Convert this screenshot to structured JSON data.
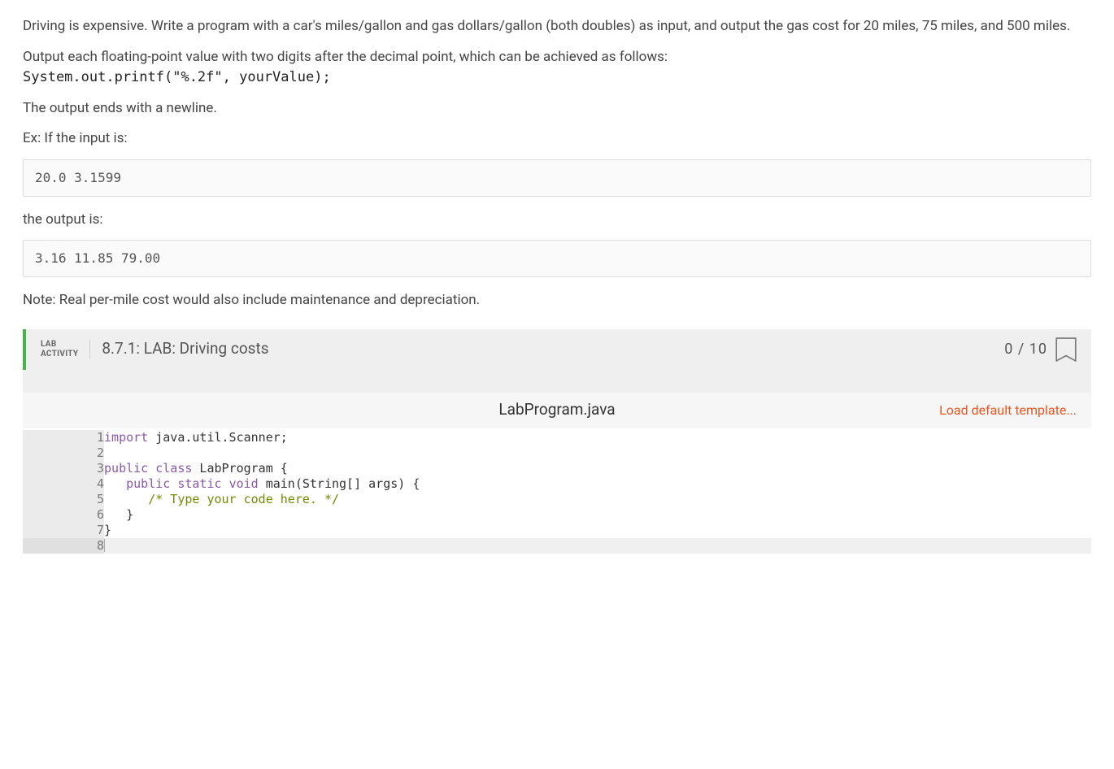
{
  "problem": {
    "p1": "Driving is expensive. Write a program with a car's miles/gallon and gas dollars/gallon (both doubles) as input, and output the gas cost for 20 miles, 75 miles, and 500 miles.",
    "p2": "Output each floating-point value with two digits after the decimal point, which can be achieved as follows:",
    "code_hint": "System.out.printf(\"%.2f\", yourValue);",
    "p3": "The output ends with a newline.",
    "p4": "Ex: If the input is:",
    "input_example": "20.0 3.1599",
    "p5": "the output is:",
    "output_example": "3.16 11.85 79.00",
    "p6": "Note: Real per-mile cost would also include maintenance and depreciation."
  },
  "lab": {
    "badge_line1": "LAB",
    "badge_line2": "ACTIVITY",
    "title": "8.7.1: LAB: Driving costs",
    "score": "0 / 10"
  },
  "editor": {
    "filename": "LabProgram.java",
    "load_template": "Load default template...",
    "lines": [
      {
        "n": "1",
        "html": "<span class='tok-key'>import</span> java.util.Scanner;"
      },
      {
        "n": "2",
        "html": ""
      },
      {
        "n": "3",
        "html": "<span class='tok-key'>public</span> <span class='tok-key'>class</span> LabProgram {"
      },
      {
        "n": "4",
        "html": "   <span class='tok-key'>public</span> <span class='tok-key'>static</span> <span class='tok-key'>void</span> main(String[] args) {"
      },
      {
        "n": "5",
        "html": "      <span class='tok-comment'>/* Type your code here. */</span>"
      },
      {
        "n": "6",
        "html": "   }"
      },
      {
        "n": "7",
        "html": "}"
      },
      {
        "n": "8",
        "html": "<span class='cursor'></span>",
        "hl": true
      }
    ]
  }
}
